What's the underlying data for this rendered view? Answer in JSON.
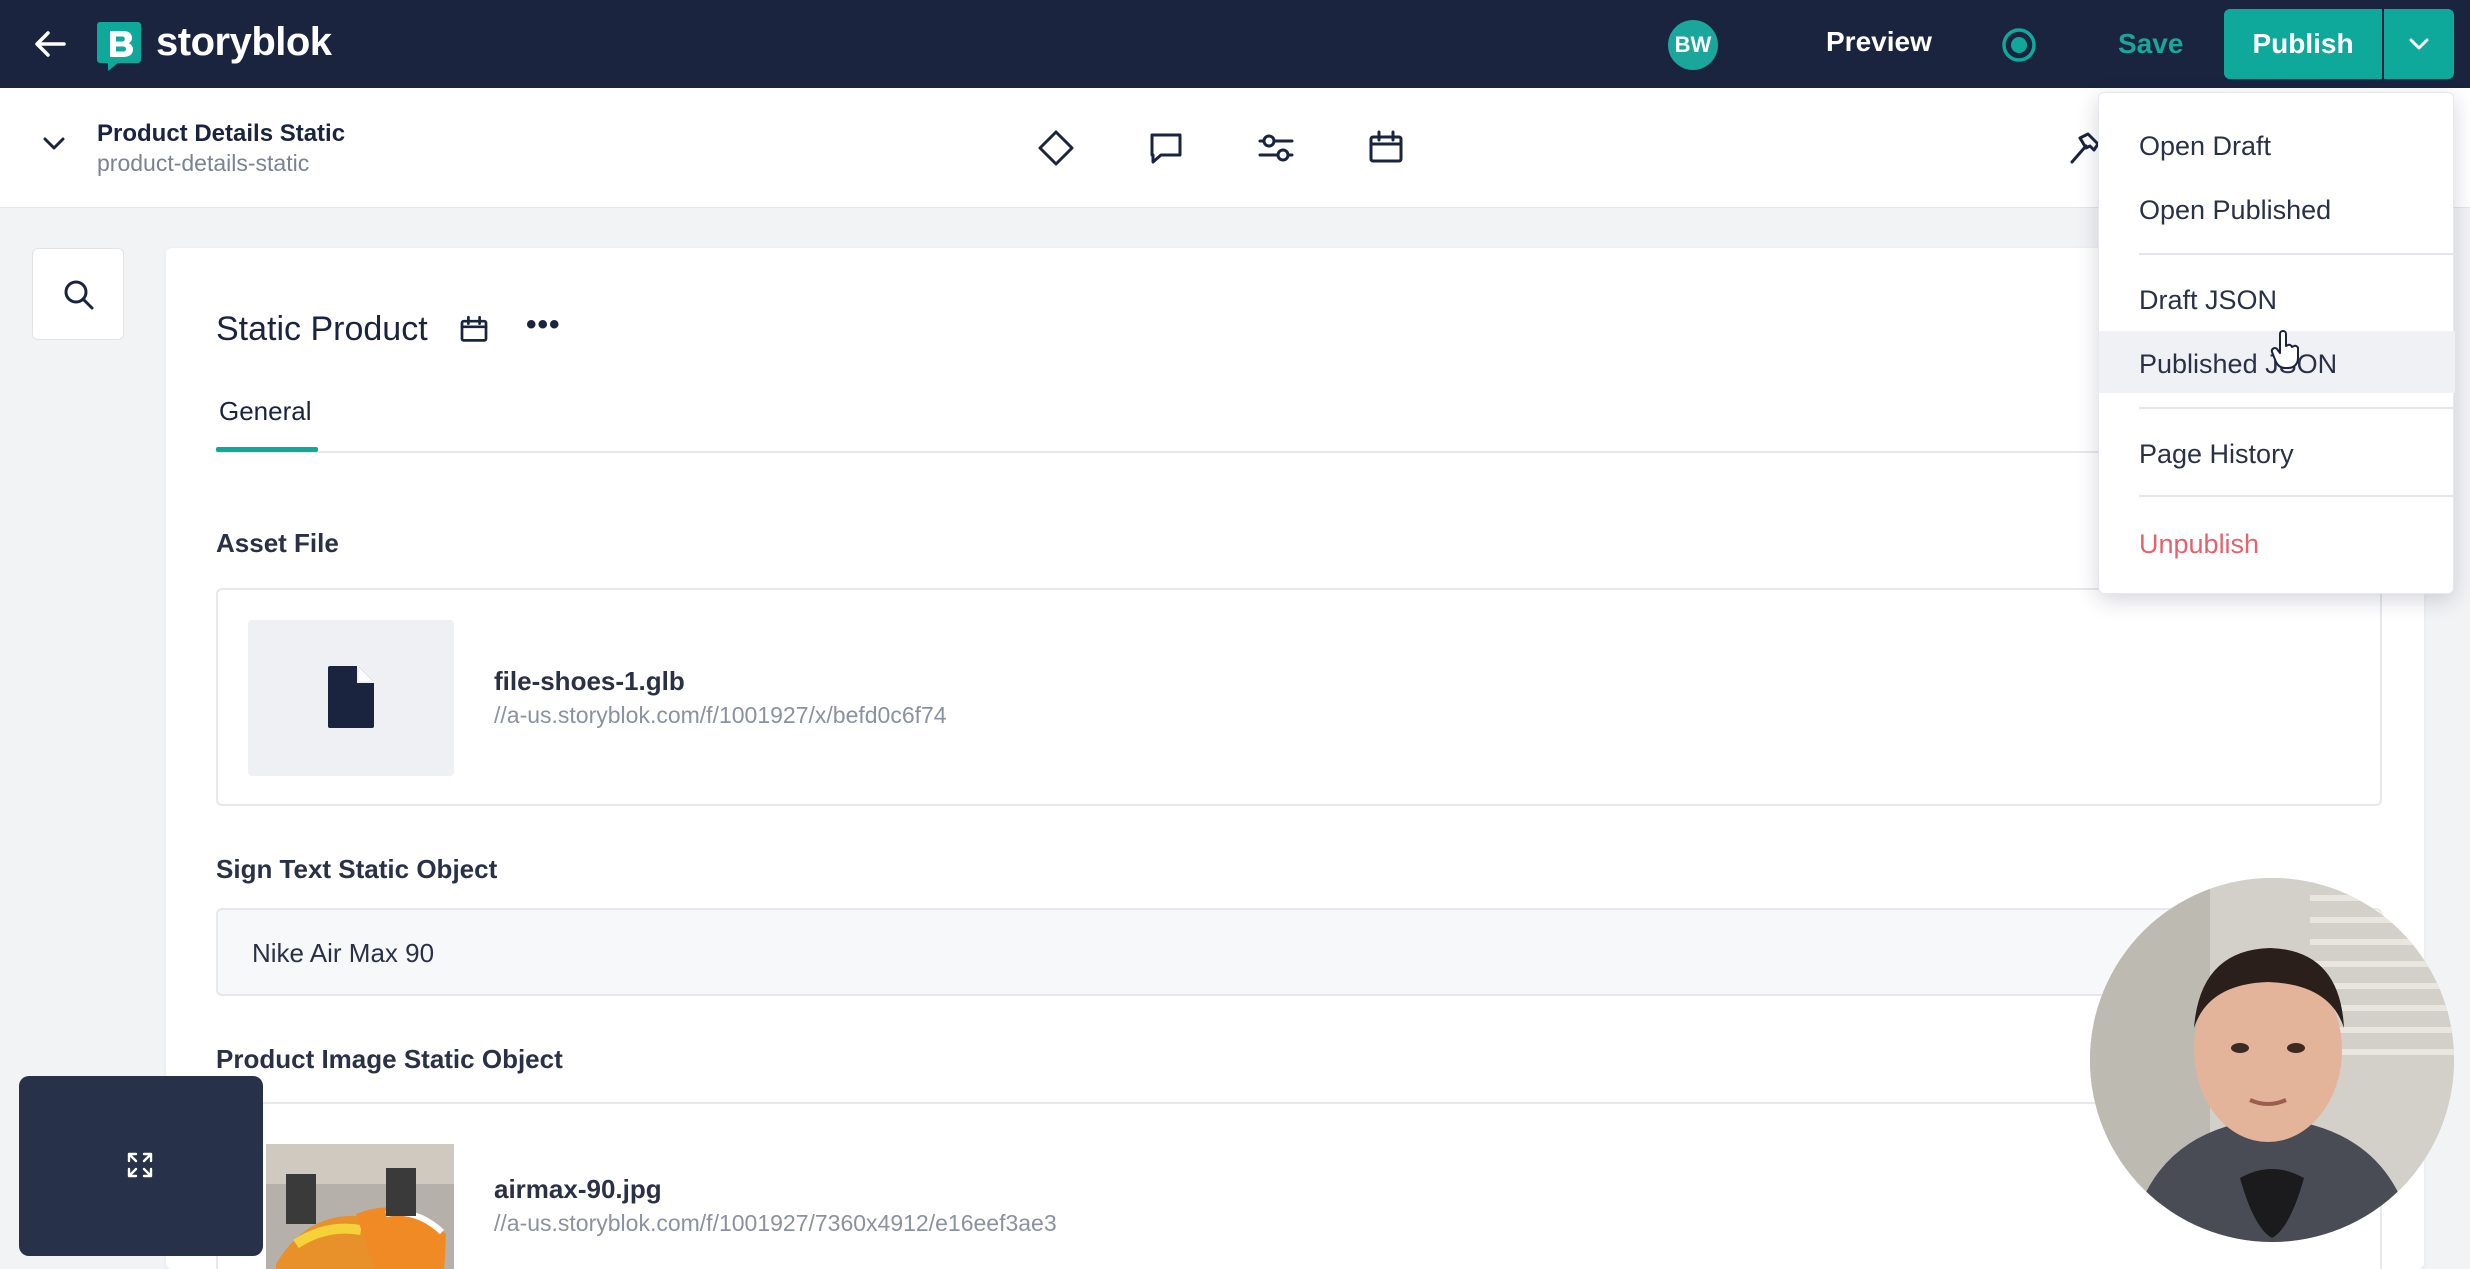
{
  "topbar": {
    "brand": "storyblok",
    "avatar_initials": "BW",
    "preview_label": "Preview",
    "save_label": "Save",
    "publish_label": "Publish"
  },
  "story": {
    "title": "Product Details Static",
    "slug": "product-details-static"
  },
  "component": {
    "title": "Static Product",
    "more_label": "•••",
    "tabs": [
      {
        "label": "General"
      }
    ]
  },
  "fields": {
    "asset_file": {
      "label": "Asset File",
      "file_name": "file-shoes-1.glb",
      "file_url": "//a-us.storyblok.com/f/1001927/x/befd0c6f74"
    },
    "sign_text": {
      "label": "Sign Text Static Object",
      "value": "Nike Air Max 90"
    },
    "product_image": {
      "label": "Product Image Static Object",
      "file_name": "airmax-90.jpg",
      "file_url": "//a-us.storyblok.com/f/1001927/7360x4912/e16eef3ae3"
    }
  },
  "publish_menu": {
    "items": [
      {
        "label": "Open Draft"
      },
      {
        "label": "Open Published"
      },
      {
        "label": "Draft JSON"
      },
      {
        "label": "Published JSON"
      },
      {
        "label": "Page History"
      },
      {
        "label": "Unpublish"
      }
    ]
  },
  "colors": {
    "topbar_bg": "#1b243f",
    "accent": "#0fa99c",
    "danger": "#e2636d"
  },
  "icons": [
    "back-arrow-icon",
    "storyblok-logo-icon",
    "target-icon",
    "chevron-down-icon",
    "diamond-icon",
    "comment-icon",
    "sliders-icon",
    "calendar-icon",
    "hammer-icon",
    "search-icon",
    "file-icon",
    "expand-icon"
  ]
}
